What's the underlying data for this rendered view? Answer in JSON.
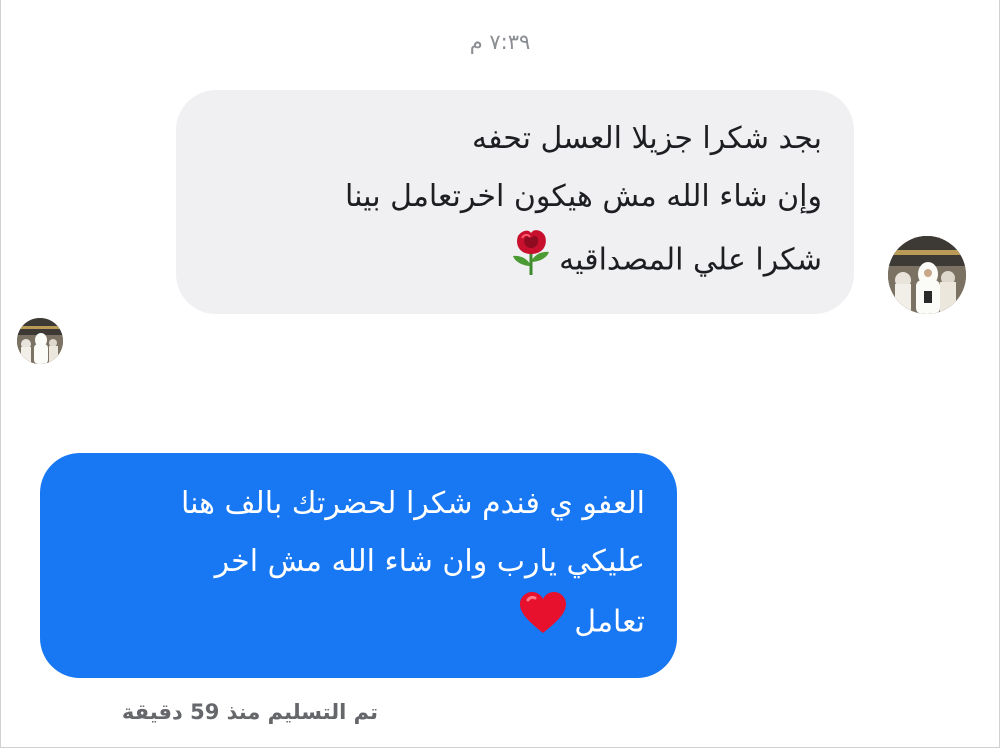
{
  "conversation": {
    "timestamp": "٧:٣٩ م",
    "messages": [
      {
        "sender": "other",
        "text": "بجد شكرا جزيلا العسل تحفه\nوإن شاء الله مش هيكون اخرتعامل  بينا\nشكرا علي المصداقيه",
        "emoji": "rose-icon"
      },
      {
        "sender": "me",
        "text": "العفو ي فندم شكرا لحضرتك بالف هنا\nعليكي يارب وان شاء الله مش اخر\nتعامل",
        "emoji": "red-heart-icon"
      }
    ],
    "delivery_status": "تم التسليم منذ 59 دقيقة"
  },
  "colors": {
    "sent_bubble": "#1877f2",
    "received_bubble": "#f0f0f2",
    "meta_text": "#8a8d91"
  }
}
